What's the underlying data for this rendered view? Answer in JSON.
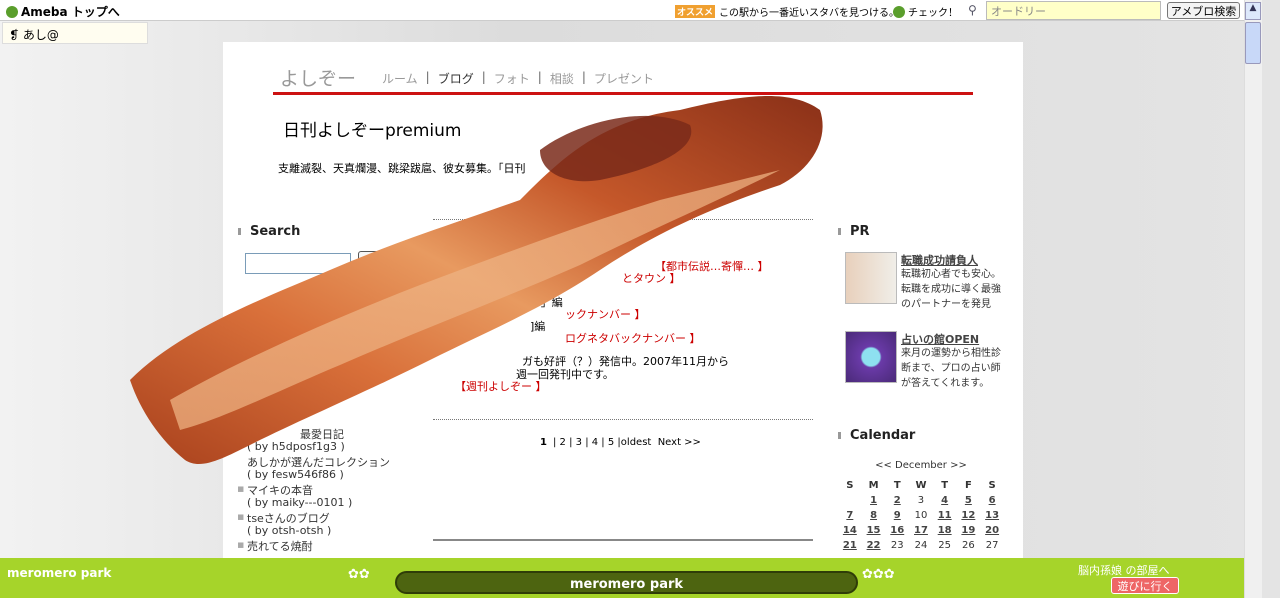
{
  "topbar": {
    "logo": "Ameba トップへ",
    "user": "あし@",
    "ad_badge": "オススメ",
    "ad_text": "この駅から一番近いスタバを見つける。",
    "check": "チェック！",
    "search_value": "オードリー",
    "search_button": "アメブロ検索"
  },
  "blog": {
    "name": "よしぞー",
    "nav": [
      "ルーム",
      "ブログ",
      "フォト",
      "相談",
      "プレゼント"
    ],
    "title": "日刊よしぞーpremium",
    "description": "支離滅裂、天真爛漫、跳梁跋扈、彼女募集。「日刊"
  },
  "search": {
    "heading": "Search",
    "button": "search"
  },
  "reader_heading_fragment": "R",
  "main": {
    "lines": [
      {
        "text": "【都市伝説…寄憚… 】",
        "red": true
      },
      {
        "text": "とタウン 】",
        "red": true
      },
      {
        "text": "s」編",
        "red": false
      },
      {
        "text": "ックナンバー 】",
        "red": true
      },
      {
        "text": "]編",
        "red": false
      },
      {
        "text": "ログネタバックナンバー 】",
        "red": true
      },
      {
        "text": "ガも好評（？）発信中。2007年11月から",
        "red": false
      },
      {
        "text": "週一回発刊中です。",
        "red": false
      },
      {
        "text": "【週刊よしぞー 】",
        "red": true
      }
    ],
    "pager": [
      "1",
      "2",
      "3",
      "4",
      "5",
      "oldest",
      "Next >>"
    ]
  },
  "links": [
    "最愛日記",
    "( by h5dposf1g3 )",
    "あしかが選んだコレクション",
    "( by fesw546f86 )",
    "マイキの本音",
    "( by maiky---0101 )",
    "tseさんのブログ",
    "( by otsh-otsh )",
    "売れてる焼酎"
  ],
  "pr": {
    "heading": "PR",
    "items": [
      {
        "title": "転職成功請負人",
        "desc": "転職初心者でも安心。転職を成功に導く最強のパートナーを発見"
      },
      {
        "title": "占いの館OPEN",
        "desc": "来月の運勢から相性診断まで、プロの占い師が答えてくれます。"
      }
    ]
  },
  "calendar": {
    "heading": "Calendar",
    "month": "<< December >>",
    "days": [
      "S",
      "M",
      "T",
      "W",
      "T",
      "F",
      "S"
    ],
    "weeks": [
      [
        "",
        "1",
        "2",
        "3",
        "4",
        "5",
        "6"
      ],
      [
        "7",
        "8",
        "9",
        "10",
        "11",
        "12",
        "13"
      ],
      [
        "14",
        "15",
        "16",
        "17",
        "18",
        "19",
        "20"
      ],
      [
        "21",
        "22",
        "23",
        "24",
        "25",
        "26",
        "27"
      ]
    ],
    "linked": [
      "1",
      "2",
      "4",
      "5",
      "6",
      "7",
      "8",
      "9",
      "11",
      "12",
      "13",
      "14",
      "15",
      "16",
      "17",
      "18",
      "19",
      "20",
      "21",
      "22"
    ]
  },
  "bottom": {
    "left_logo": "meromero park",
    "center": "meromero park",
    "room": "脳内孫娘 の部屋へ",
    "play": "遊びに行く"
  },
  "colors": {
    "accent_red": "#cc1111",
    "bottom_green": "#a6d42a"
  }
}
